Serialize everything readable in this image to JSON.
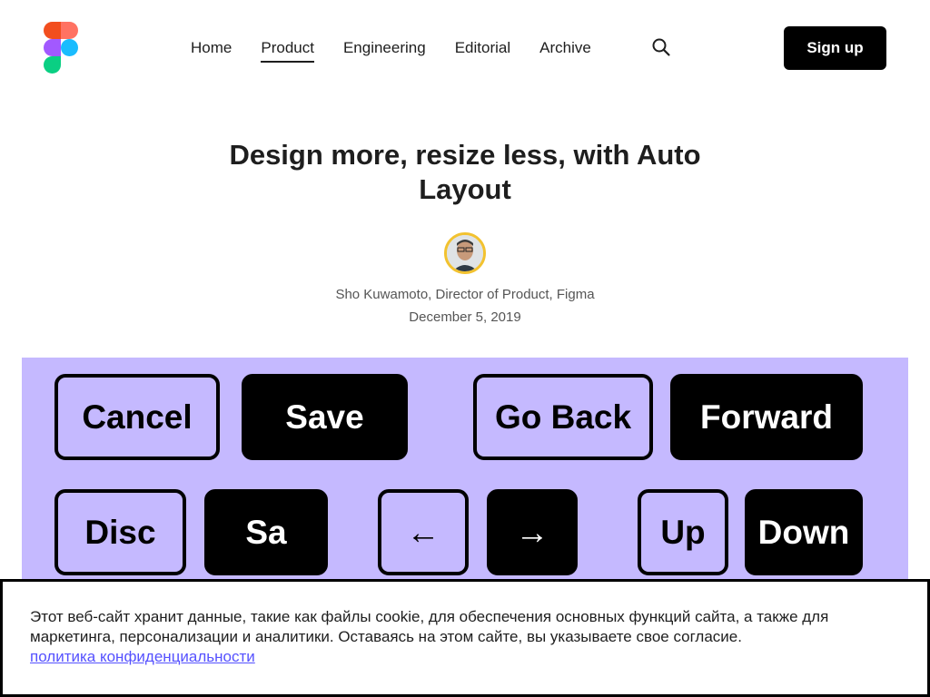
{
  "brand": {
    "logo_icon": "figma-logo-icon",
    "colors": {
      "red": "#f24e1e",
      "orange": "#ff7262",
      "purple": "#a259ff",
      "blue": "#1abcfe",
      "green": "#0acf83"
    }
  },
  "nav": {
    "items": [
      "Home",
      "Product",
      "Engineering",
      "Editorial",
      "Archive"
    ],
    "active": "Product",
    "search_icon": "search-icon"
  },
  "header": {
    "signup_label": "Sign up"
  },
  "article": {
    "title": "Design more, resize less, with Auto Layout",
    "author": "Sho Kuwamoto, Director of Product, Figma",
    "date": "December 5, 2019"
  },
  "hero": {
    "background": "#c5b9ff",
    "buttons": [
      "Cancel",
      "Save",
      "Go Back",
      "Forward",
      "Disc",
      "Sa",
      "←",
      "→",
      "Up",
      "Down"
    ]
  },
  "cookie": {
    "text": "Этот веб-сайт хранит данные, такие как файлы cookie, для обеспечения основных функций сайта, а также для маркетинга, персонализации и аналитики. Оставаясь на этом сайте, вы указываете свое согласие.",
    "link": "политика конфиденциальности"
  }
}
